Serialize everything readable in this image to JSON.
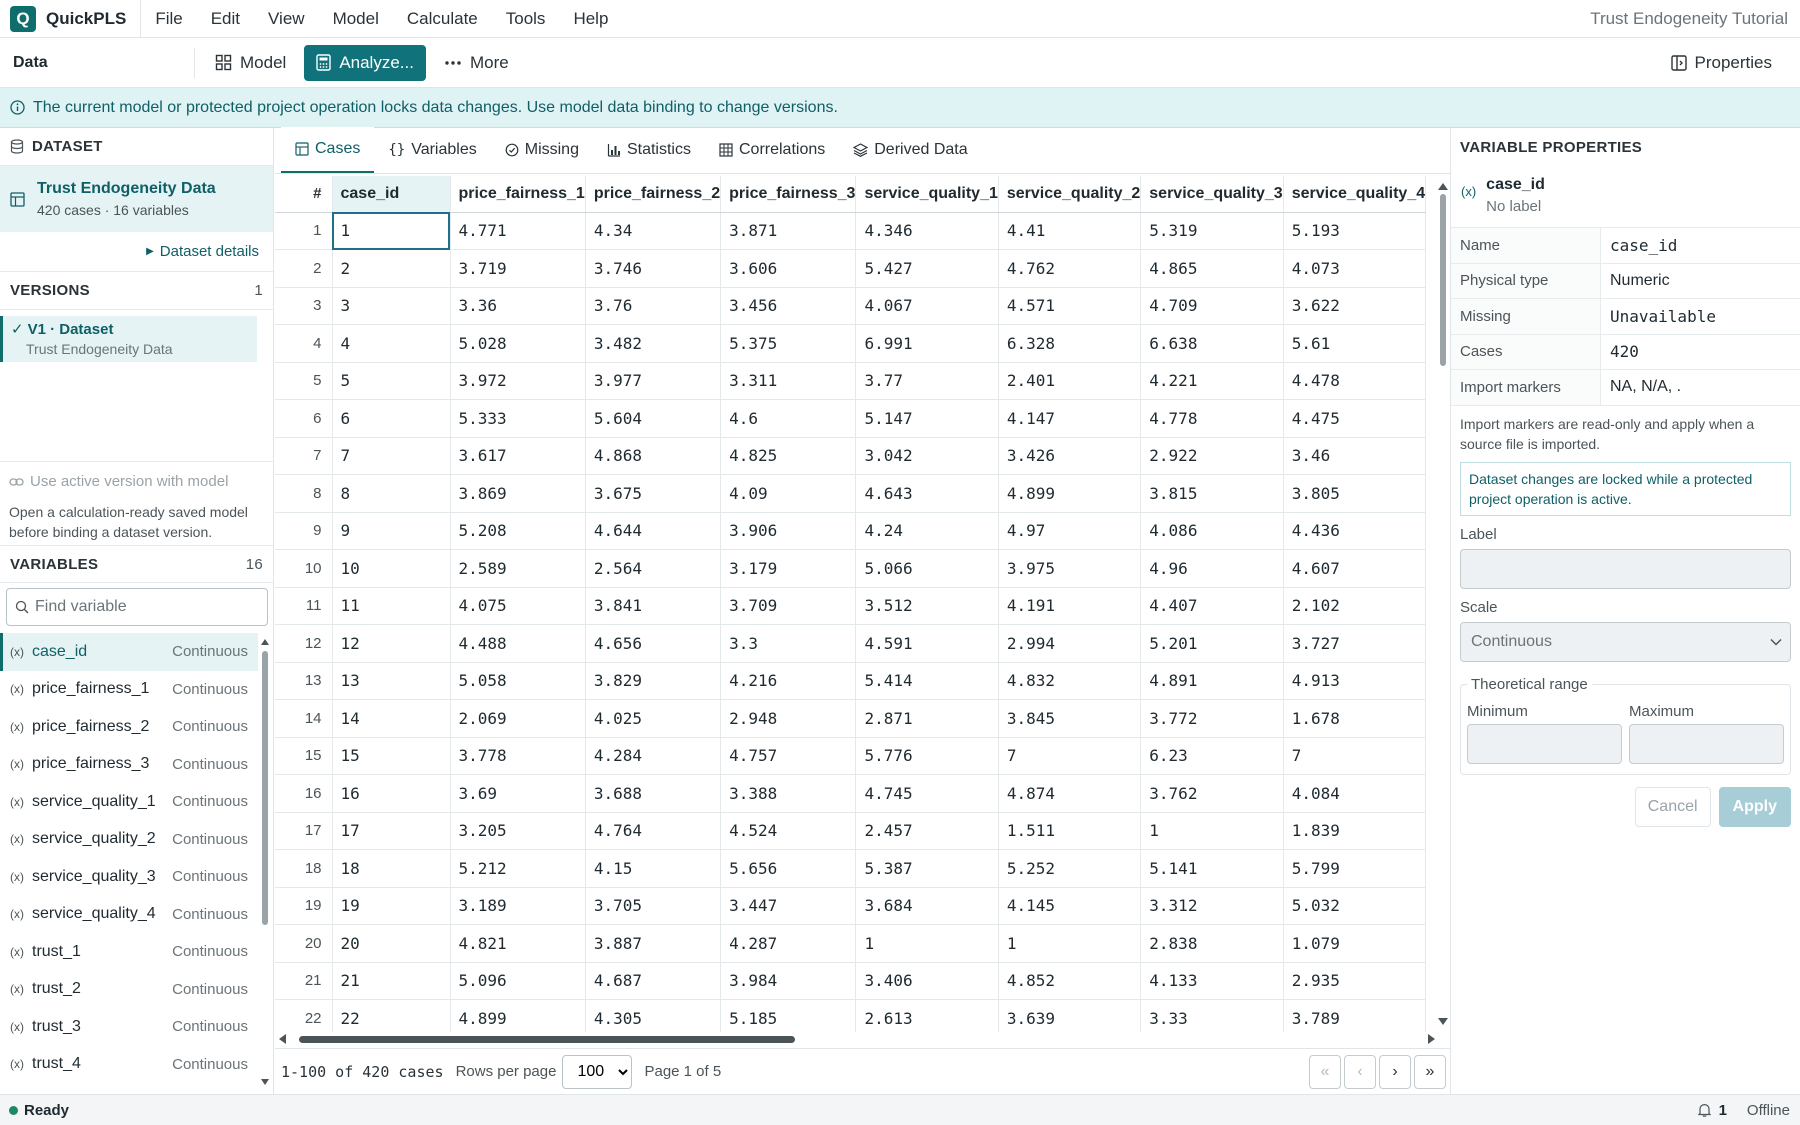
{
  "app": {
    "logo_letter": "Q",
    "name": "QuickPLS",
    "project_title": "Trust Endogeneity Tutorial",
    "menu": [
      "File",
      "Edit",
      "View",
      "Model",
      "Calculate",
      "Tools",
      "Help"
    ]
  },
  "toolbar": {
    "section_label": "Data",
    "model_label": "Model",
    "analyze_label": "Analyze...",
    "more_label": "More",
    "properties_label": "Properties"
  },
  "banner": {
    "text": "The current model or protected project operation locks data changes. Use model data binding to change versions."
  },
  "dataset": {
    "heading": "DATASET",
    "name": "Trust Endogeneity Data",
    "summary": "420 cases · 16 variables",
    "details_link": "Dataset details"
  },
  "versions": {
    "heading": "VERSIONS",
    "count": "1",
    "items": [
      {
        "label": "V1 · Dataset",
        "sub": "Trust Endogeneity Data"
      }
    ],
    "use_active_label": "Use active version with model",
    "bind_note": "Open a calculation-ready saved model before binding a dataset version."
  },
  "variables": {
    "heading": "VARIABLES",
    "count": "16",
    "search_placeholder": "Find variable",
    "items": [
      {
        "name": "case_id",
        "type": "Continuous"
      },
      {
        "name": "price_fairness_1",
        "type": "Continuous"
      },
      {
        "name": "price_fairness_2",
        "type": "Continuous"
      },
      {
        "name": "price_fairness_3",
        "type": "Continuous"
      },
      {
        "name": "service_quality_1",
        "type": "Continuous"
      },
      {
        "name": "service_quality_2",
        "type": "Continuous"
      },
      {
        "name": "service_quality_3",
        "type": "Continuous"
      },
      {
        "name": "service_quality_4",
        "type": "Continuous"
      },
      {
        "name": "trust_1",
        "type": "Continuous"
      },
      {
        "name": "trust_2",
        "type": "Continuous"
      },
      {
        "name": "trust_3",
        "type": "Continuous"
      },
      {
        "name": "trust_4",
        "type": "Continuous"
      }
    ]
  },
  "tabs": [
    "Cases",
    "Variables",
    "Missing",
    "Statistics",
    "Correlations",
    "Derived Data"
  ],
  "grid": {
    "row_header": "#",
    "columns": [
      "case_id",
      "price_fairness_1",
      "price_fairness_2",
      "price_fairness_3",
      "service_quality_1",
      "service_quality_2",
      "service_quality_3",
      "service_quality_4"
    ],
    "rows": [
      [
        "1",
        "1",
        "4.771",
        "4.34",
        "3.871",
        "4.346",
        "4.41",
        "5.319",
        "5.193"
      ],
      [
        "2",
        "2",
        "3.719",
        "3.746",
        "3.606",
        "5.427",
        "4.762",
        "4.865",
        "4.073"
      ],
      [
        "3",
        "3",
        "3.36",
        "3.76",
        "3.456",
        "4.067",
        "4.571",
        "4.709",
        "3.622"
      ],
      [
        "4",
        "4",
        "5.028",
        "3.482",
        "5.375",
        "6.991",
        "6.328",
        "6.638",
        "5.61"
      ],
      [
        "5",
        "5",
        "3.972",
        "3.977",
        "3.311",
        "3.77",
        "2.401",
        "4.221",
        "4.478"
      ],
      [
        "6",
        "6",
        "5.333",
        "5.604",
        "4.6",
        "5.147",
        "4.147",
        "4.778",
        "4.475"
      ],
      [
        "7",
        "7",
        "3.617",
        "4.868",
        "4.825",
        "3.042",
        "3.426",
        "2.922",
        "3.46"
      ],
      [
        "8",
        "8",
        "3.869",
        "3.675",
        "4.09",
        "4.643",
        "4.899",
        "3.815",
        "3.805"
      ],
      [
        "9",
        "9",
        "5.208",
        "4.644",
        "3.906",
        "4.24",
        "4.97",
        "4.086",
        "4.436"
      ],
      [
        "10",
        "10",
        "2.589",
        "2.564",
        "3.179",
        "5.066",
        "3.975",
        "4.96",
        "4.607"
      ],
      [
        "11",
        "11",
        "4.075",
        "3.841",
        "3.709",
        "3.512",
        "4.191",
        "4.407",
        "2.102"
      ],
      [
        "12",
        "12",
        "4.488",
        "4.656",
        "3.3",
        "4.591",
        "2.994",
        "5.201",
        "3.727"
      ],
      [
        "13",
        "13",
        "5.058",
        "3.829",
        "4.216",
        "5.414",
        "4.832",
        "4.891",
        "4.913"
      ],
      [
        "14",
        "14",
        "2.069",
        "4.025",
        "2.948",
        "2.871",
        "3.845",
        "3.772",
        "1.678"
      ],
      [
        "15",
        "15",
        "3.778",
        "4.284",
        "4.757",
        "5.776",
        "7",
        "6.23",
        "7"
      ],
      [
        "16",
        "16",
        "3.69",
        "3.688",
        "3.388",
        "4.745",
        "4.874",
        "3.762",
        "4.084"
      ],
      [
        "17",
        "17",
        "3.205",
        "4.764",
        "4.524",
        "2.457",
        "1.511",
        "1",
        "1.839"
      ],
      [
        "18",
        "18",
        "5.212",
        "4.15",
        "5.656",
        "5.387",
        "5.252",
        "5.141",
        "5.799"
      ],
      [
        "19",
        "19",
        "3.189",
        "3.705",
        "3.447",
        "3.684",
        "4.145",
        "3.312",
        "5.032"
      ],
      [
        "20",
        "20",
        "4.821",
        "3.887",
        "4.287",
        "1",
        "1",
        "2.838",
        "1.079"
      ],
      [
        "21",
        "21",
        "5.096",
        "4.687",
        "3.984",
        "3.406",
        "4.852",
        "4.133",
        "2.935"
      ],
      [
        "22",
        "22",
        "4.899",
        "4.305",
        "5.185",
        "2.613",
        "3.639",
        "3.33",
        "3.789"
      ]
    ]
  },
  "pager": {
    "range_text": "1-100 of 420 cases",
    "rows_per_page_label": "Rows per page",
    "rows_per_page": "100",
    "page_text": "Page 1 of 5"
  },
  "properties": {
    "heading": "VARIABLE PROPERTIES",
    "var_name": "case_id",
    "var_label": "No label",
    "fields": [
      {
        "key": "Name",
        "value": "case_id",
        "mono": true
      },
      {
        "key": "Physical type",
        "value": "Numeric",
        "mono": false
      },
      {
        "key": "Missing",
        "value": "Unavailable",
        "mono": true
      },
      {
        "key": "Cases",
        "value": "420",
        "mono": true
      },
      {
        "key": "Import markers",
        "value": "NA, N/A, .",
        "mono": false
      }
    ],
    "import_note": "Import markers are read-only and apply when a source file is imported.",
    "lock_note": "Dataset changes are locked while a protected project operation is active.",
    "label_label": "Label",
    "scale_label": "Scale",
    "scale_value": "Continuous",
    "range_legend": "Theoretical range",
    "min_label": "Minimum",
    "max_label": "Maximum",
    "cancel_label": "Cancel",
    "apply_label": "Apply"
  },
  "status": {
    "state": "Ready",
    "notifications": "1",
    "connection": "Offline"
  },
  "colors": {
    "accent": "#0f6e6c",
    "primary_button": "#10727a",
    "banner_bg": "#dff2f4",
    "ready_dot": "#1b8a62"
  }
}
